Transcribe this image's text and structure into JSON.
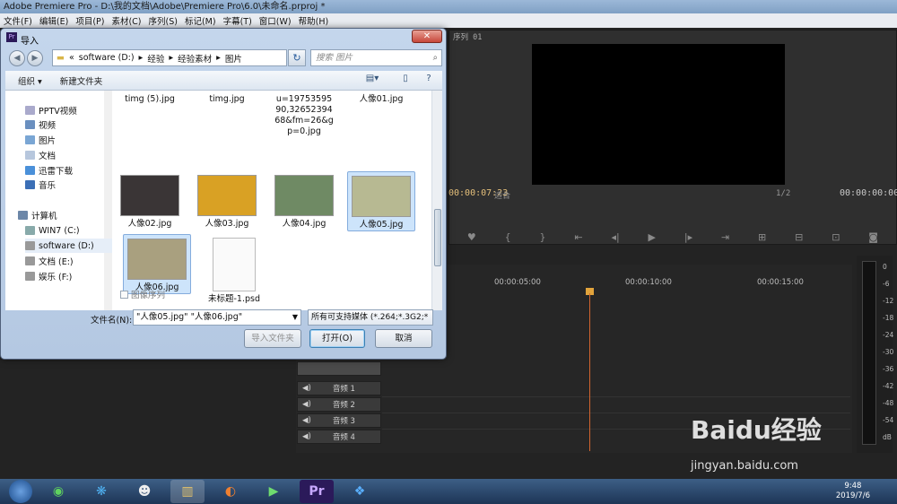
{
  "window": {
    "title": "Adobe Premiere Pro - D:\\我的文档\\Adobe\\Premiere Pro\\6.0\\未命名.prproj *"
  },
  "menu": [
    "文件(F)",
    "编辑(E)",
    "项目(P)",
    "素材(C)",
    "序列(S)",
    "标记(M)",
    "字幕(T)",
    "窗口(W)",
    "帮助(H)"
  ],
  "premiere": {
    "sequence_tab": "序列 01",
    "tc_left": "00:00:07:23",
    "fit_label": "适合",
    "zoom": "1/2",
    "tc_right": "00:00:00:00",
    "ruler": [
      "00:00:05:00",
      "00:00:10:00",
      "00:00:15:00"
    ],
    "audio_tracks": [
      "音频 1",
      "音频 2",
      "音频 3",
      "音频 4"
    ],
    "meter_labels": [
      "0",
      "-6",
      "-12",
      "-18",
      "-24",
      "-30",
      "-36",
      "-42",
      "-48",
      "-54",
      "dB"
    ]
  },
  "dialog": {
    "title": "导入",
    "close_label": "✕",
    "address": [
      "software (D:)",
      "经验",
      "经验素材",
      "图片"
    ],
    "search_placeholder": "搜索 图片",
    "organize": "组织 ▾",
    "new_folder": "新建文件夹",
    "nav_items": [
      "PPTV视频",
      "视频",
      "图片",
      "文档",
      "迅雷下载",
      "音乐",
      "计算机",
      "WIN7 (C:)",
      "software (D:)",
      "文档 (E:)",
      "娱乐 (F:)"
    ],
    "files": [
      {
        "name": "timg (5).jpg",
        "color": "#b9b9b9"
      },
      {
        "name": "timg.jpg",
        "color": "#c9c9c9"
      },
      {
        "name": "u=1975359590,3265239468&fm=26&gp=0.jpg",
        "color": ""
      },
      {
        "name": "人像01.jpg",
        "color": "#d9d3cc"
      },
      {
        "name": "人像02.jpg",
        "color": "#3a3536"
      },
      {
        "name": "人像03.jpg",
        "color": "#d9a124"
      },
      {
        "name": "人像04.jpg",
        "color": "#6f8a64"
      },
      {
        "name": "人像05.jpg",
        "color": "#b7b992"
      },
      {
        "name": "人像06.jpg",
        "color": "#a9a07f"
      },
      {
        "name": "未标题-1.psd",
        "color": "#ffffff"
      }
    ],
    "image_sequence": "图像序列",
    "filename_label": "文件名(N):",
    "filename_value": "\"人像05.jpg\" \"人像06.jpg\"",
    "filetype": "所有可支持媒体 (*.264;*.3G2;*",
    "import_folder": "导入文件夹",
    "open": "打开(O)",
    "cancel": "取消"
  },
  "taskbar": {
    "time": "9:48",
    "date": "2019/7/6"
  },
  "watermark": {
    "brand": "Baidu经验",
    "url": "jingyan.baidu.com"
  }
}
